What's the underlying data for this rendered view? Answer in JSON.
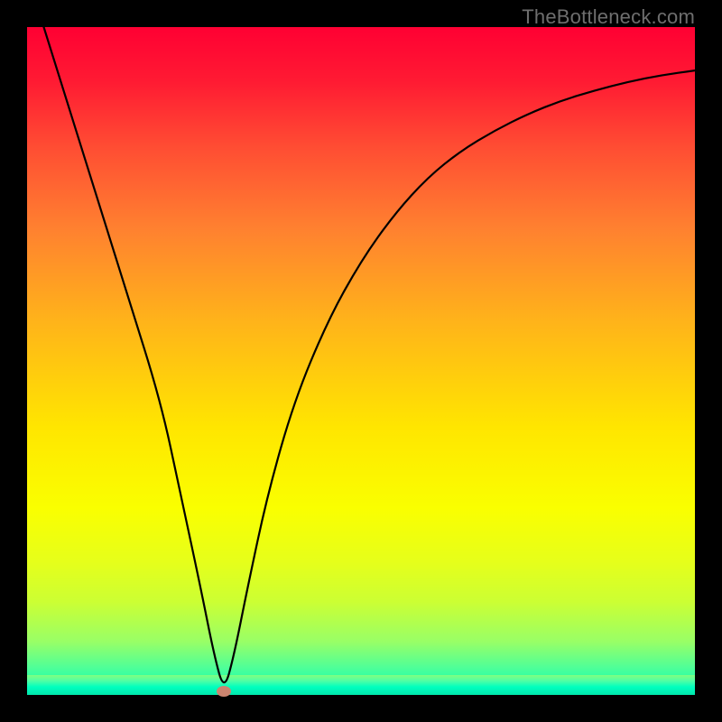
{
  "watermark": "TheBottleneck.com",
  "chart_data": {
    "type": "line",
    "title": "",
    "xlabel": "",
    "ylabel": "",
    "xlim": [
      0,
      100
    ],
    "ylim": [
      0,
      100
    ],
    "grid": false,
    "series": [
      {
        "name": "bottleneck-curve",
        "x": [
          0,
          5,
          10,
          15,
          20,
          23,
          26,
          28,
          29.5,
          31,
          33,
          36,
          40,
          45,
          50,
          55,
          60,
          65,
          70,
          75,
          80,
          85,
          90,
          95,
          100
        ],
        "values": [
          108,
          92,
          76,
          60,
          44,
          30,
          16,
          6,
          0.5,
          6,
          16,
          30,
          44,
          56,
          65,
          72,
          77.5,
          81.5,
          84.5,
          87,
          89,
          90.5,
          91.8,
          92.8,
          93.5
        ]
      }
    ],
    "background_gradient": {
      "top": "#ff0033",
      "upper_mid": "#ffb31a",
      "mid": "#ffe600",
      "lower_mid": "#ccff33",
      "bottom": "#00ffb3"
    },
    "marker": {
      "name": "optimum-point",
      "x": 29.5,
      "y": 0.5,
      "color": "#cc8570"
    }
  }
}
